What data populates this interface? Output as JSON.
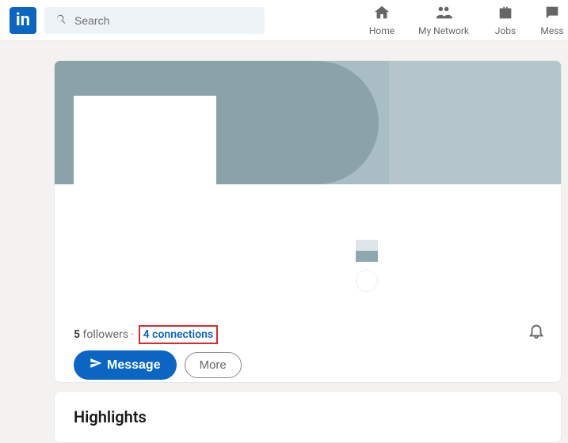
{
  "header": {
    "logo_text": "in",
    "search_placeholder": "Search"
  },
  "nav": {
    "home": "Home",
    "network": "My Network",
    "jobs": "Jobs",
    "messaging": "Mess"
  },
  "profile": {
    "followers_count": "5",
    "followers_label": "followers",
    "connections_count": "4",
    "connections_label": "connections",
    "message_button": "Message",
    "more_button": "More"
  },
  "highlights": {
    "title": "Highlights"
  }
}
